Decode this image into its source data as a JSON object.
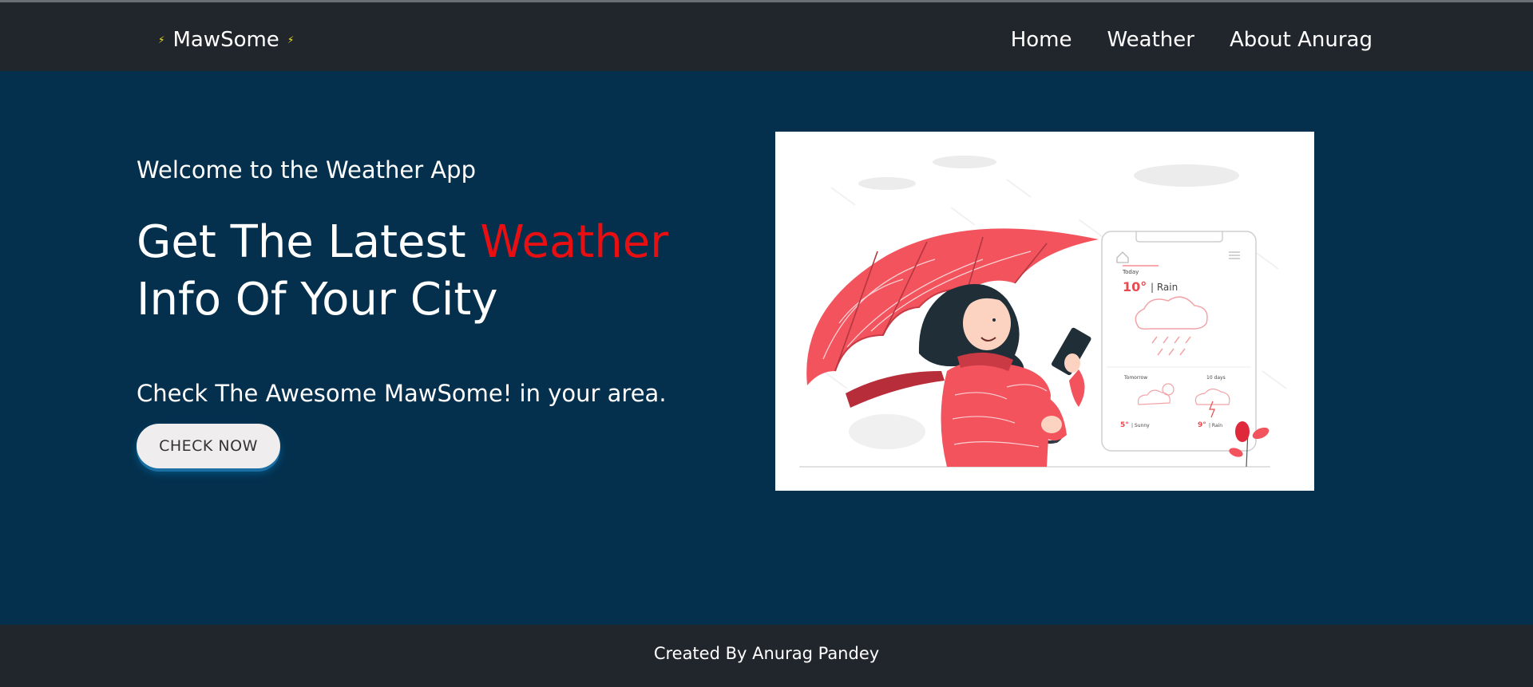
{
  "navbar": {
    "brand": "MawSome",
    "links": [
      {
        "label": "Home"
      },
      {
        "label": "Weather"
      },
      {
        "label": "About Anurag"
      }
    ]
  },
  "hero": {
    "subtitle": "Welcome to the Weather App",
    "title_part1": "Get The Latest ",
    "title_accent": "Weather",
    "title_part2": "Info Of Your City",
    "tagline": "Check The Awesome MawSome! in your area.",
    "button_label": "CHECK NOW"
  },
  "illustration": {
    "phone": {
      "today_label": "Today",
      "today_temp": "10°",
      "today_cond": "| Rain",
      "tomorrow_label": "Tomorrow",
      "tomorrow_temp": "5°",
      "tomorrow_cond": "| Sunny",
      "tenday_label": "10 days",
      "tenday_temp": "9°",
      "tenday_cond": "| Rain"
    }
  },
  "footer": {
    "credit": "Created By Anurag Pandey"
  },
  "colors": {
    "page_bg": "#04304d",
    "navbar_bg": "#21262d",
    "accent_red": "#e70f12",
    "umbrella_red": "#f2535d",
    "bolt_yellow": "#f4e81f",
    "button_bg": "#efeded"
  }
}
